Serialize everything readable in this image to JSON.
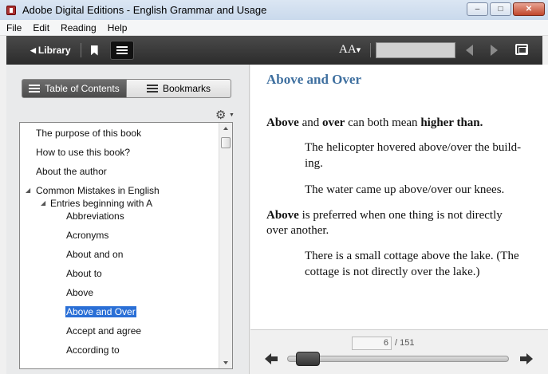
{
  "window": {
    "title": "Adobe Digital Editions - English Grammar and Usage",
    "minimize": "–",
    "maximize": "□",
    "close": "✕"
  },
  "menu": [
    "File",
    "Edit",
    "Reading",
    "Help"
  ],
  "toolbar": {
    "library_label": "Library",
    "font_size_label": "AA",
    "search_value": ""
  },
  "sidebar": {
    "tabs": [
      {
        "label": "Table of Contents",
        "active": true
      },
      {
        "label": "Bookmarks",
        "active": false
      }
    ],
    "toc": [
      {
        "label": "The purpose of this book",
        "level": 0
      },
      {
        "label": "How to use this book?",
        "level": 0
      },
      {
        "label": "About the author",
        "level": 0
      },
      {
        "label": "Common Mistakes in English",
        "level": 0,
        "expanded": true
      },
      {
        "label": "Entries beginning with A",
        "level": 1,
        "expanded": true
      },
      {
        "label": "Abbreviations",
        "level": 2
      },
      {
        "label": "Acronyms",
        "level": 2
      },
      {
        "label": "About and on",
        "level": 2
      },
      {
        "label": "About to",
        "level": 2
      },
      {
        "label": "Above",
        "level": 2
      },
      {
        "label": "Above and Over",
        "level": 2,
        "selected": true
      },
      {
        "label": "Accept and agree",
        "level": 2
      },
      {
        "label": "According to",
        "level": 2
      }
    ]
  },
  "content": {
    "title": "Above and Over",
    "p1_b1": "Above",
    "p1_t1": " and ",
    "p1_b2": "over",
    "p1_t2": " can both mean ",
    "p1_b3": "higher than.",
    "ex1_line1": "The helicopter hovered above/over the build-",
    "ex1_line2": "ing.",
    "ex2": "The water came up above/over our knees.",
    "p2_b1": "Above",
    "p2_line1": " is preferred when one thing is not directly",
    "p2_line2": "over another.",
    "ex3_line1": "There is a small cottage above the lake. (The",
    "ex3_line2": "cottage is not directly over the lake.)"
  },
  "pager": {
    "current_page": "6",
    "total_pages": "/ 151",
    "progress": 0.04
  }
}
